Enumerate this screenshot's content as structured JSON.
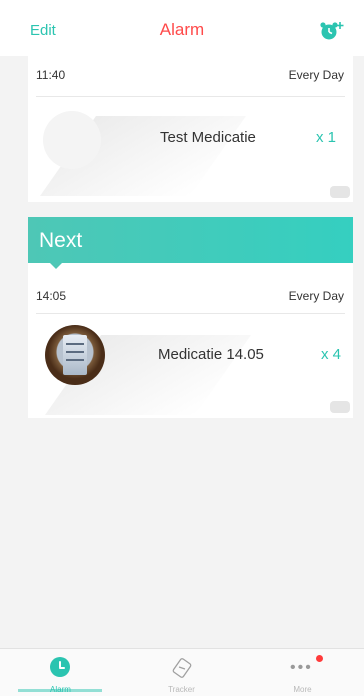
{
  "nav": {
    "edit_label": "Edit",
    "title": "Alarm",
    "add_icon": "alarm-add-icon"
  },
  "colors": {
    "accent": "#2bc4b0",
    "title": "#ff4a4a",
    "badge": "#ff3b3b"
  },
  "alarms": [
    {
      "time": "11:40",
      "frequency": "Every Day",
      "medication": "Test Medicatie",
      "dose": "x 1",
      "image": "placeholder-pill-icon"
    },
    {
      "banner": "Next",
      "time": "14:05",
      "frequency": "Every Day",
      "medication": "Medicatie 14.05",
      "dose": "x 4",
      "image": "medication-photo"
    }
  ],
  "tabbar": {
    "tabs": [
      {
        "label": "Alarm",
        "icon": "clock-icon",
        "active": true
      },
      {
        "label": "Tracker",
        "icon": "tracker-icon",
        "active": false
      },
      {
        "label": "More",
        "icon": "more-icon",
        "active": false
      }
    ]
  }
}
